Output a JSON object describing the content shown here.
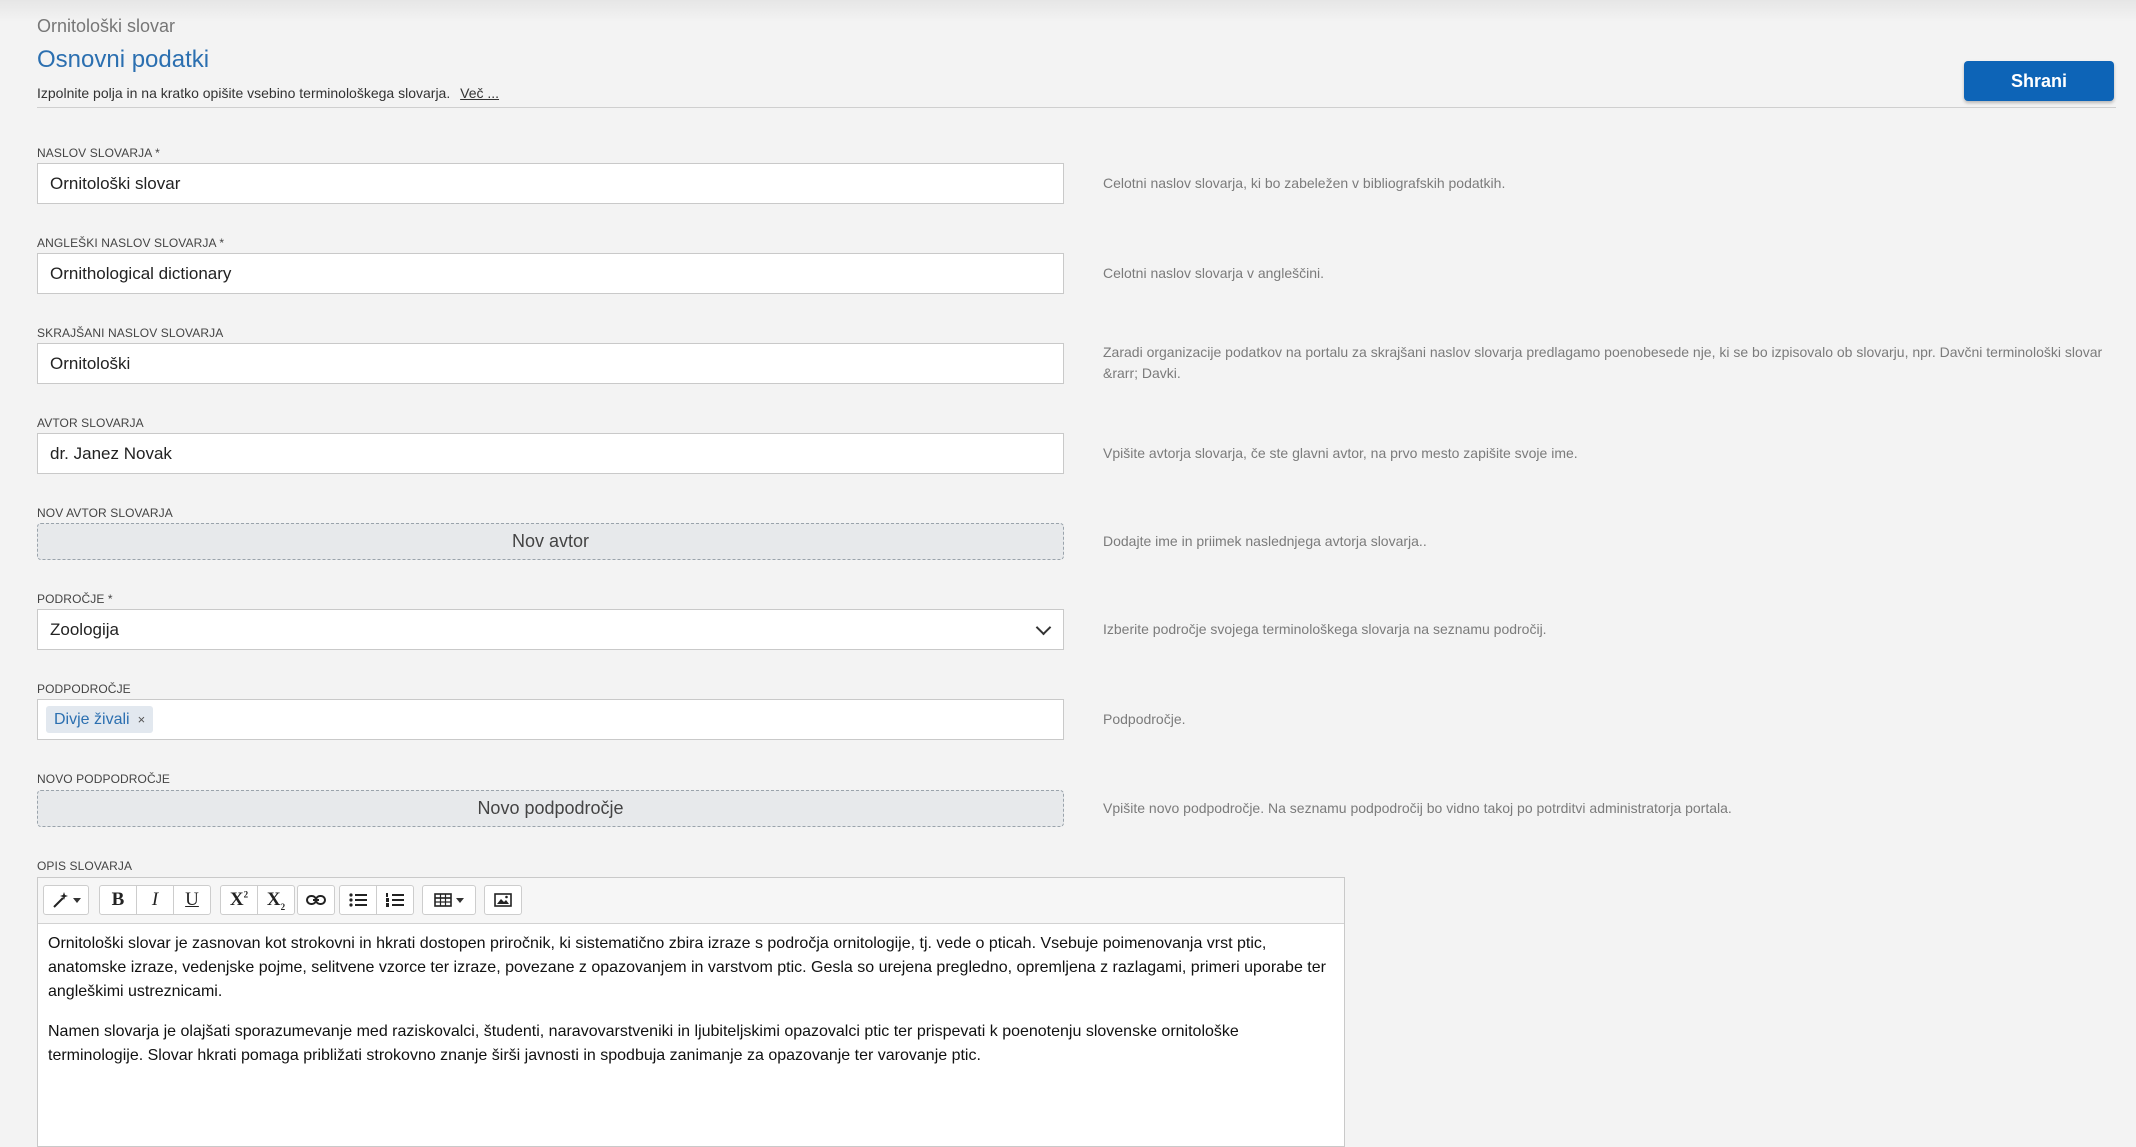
{
  "header": {
    "breadcrumb": "Ornitološki slovar",
    "title": "Osnovni podatki",
    "intro": "Izpolnite polja in na kratko opišite vsebino terminološkega slovarja.",
    "more_link": "Več ...",
    "save_label": "Shrani"
  },
  "fields": {
    "title": {
      "label": "NASLOV SLOVARJA *",
      "value": "Ornitološki slovar",
      "help": "Celotni naslov slovarja, ki bo zabeležen v bibliografskih podatkih."
    },
    "english_title": {
      "label": "ANGLEŠKI NASLOV SLOVARJA *",
      "value": "Ornithological dictionary",
      "help": "Celotni naslov slovarja v angleščini."
    },
    "short_title": {
      "label": "SKRAJŠANI NASLOV SLOVARJA",
      "value": "Ornitološki",
      "help": "Zaradi organizacije podatkov na portalu za skrajšani naslov slovarja predlagamo poenobesede nje, ki se bo izpisovalo ob slovarju, npr. Davčni terminološki slovar &rarr; Davki."
    },
    "author": {
      "label": "AVTOR SLOVARJA",
      "value": "dr. Janez Novak",
      "help": "Vpišite avtorja slovarja, če ste glavni avtor, na prvo mesto zapišite svoje ime."
    },
    "new_author": {
      "label": "NOV AVTOR SLOVARJA",
      "button": "Nov avtor",
      "help": "Dodajte ime in priimek naslednjega avtorja slovarja.."
    },
    "domain": {
      "label": "PODROČJE *",
      "value": "Zoologija",
      "help": "Izberite področje svojega terminološkega slovarja na seznamu področij."
    },
    "subdomain": {
      "label": "PODPODROČJE",
      "tag": "Divje živali",
      "tag_remove": "×",
      "help": "Podpodročje."
    },
    "new_subdomain": {
      "label": "NOVO PODPODROČJE",
      "button": "Novo podpodročje",
      "help": "Vpišite novo podpodročje. Na seznamu podpodročij bo vidno takoj po potrditvi administratorja portala."
    }
  },
  "description": {
    "label": "OPIS SLOVARJA",
    "toolbar_icons": [
      "magic-wand-icon",
      "bold-icon",
      "italic-icon",
      "underline-icon",
      "superscript-icon",
      "subscript-icon",
      "link-icon",
      "bullet-list-icon",
      "numbered-list-icon",
      "table-icon",
      "image-icon"
    ],
    "paragraphs": [
      "Ornitološki slovar je zasnovan kot strokovni in hkrati dostopen priročnik, ki sistematično zbira izraze s področja ornitologije, tj. vede o pticah. Vsebuje poimenovanja vrst ptic, anatomske izraze, vedenjske pojme, selitvene vzorce ter izraze, povezane z opazovanjem in varstvom ptic. Gesla so urejena pregledno, opremljena z razlagami, primeri uporabe ter angleškimi ustreznicami.",
      "Namen slovarja je olajšati sporazumevanje med raziskovalci, študenti, naravovarstveniki in ljubiteljskimi opazovalci ptic ter prispevati k poenotenju slovenske ornitološke terminologije. Slovar hkrati pomaga približati strokovno znanje širši javnosti in spodbuja zanimanje za opazovanje ter varovanje ptic."
    ]
  }
}
